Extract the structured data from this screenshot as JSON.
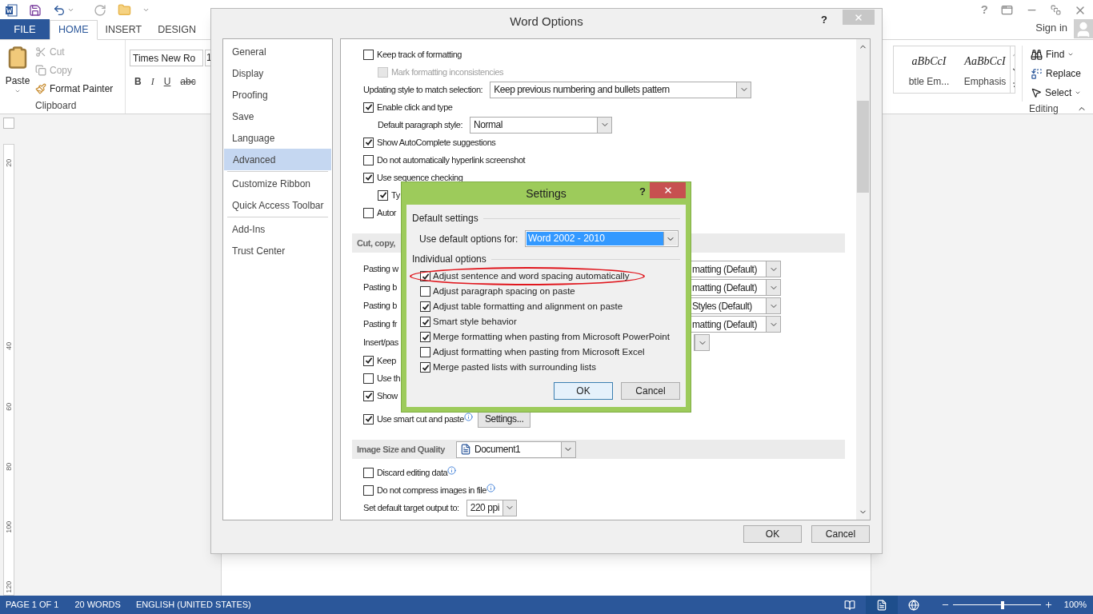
{
  "tabs": [
    {
      "label": "FILE",
      "kind": "file",
      "selected": false
    },
    {
      "label": "HOME",
      "kind": "tab",
      "selected": true
    },
    {
      "label": "INSERT",
      "kind": "tab",
      "selected": false
    },
    {
      "label": "DESIGN",
      "kind": "tab",
      "selected": false
    }
  ],
  "account": {
    "sign_in": "Sign in"
  },
  "ribbon": {
    "clipboard": {
      "paste": "Paste",
      "cut": {
        "label": "Cut",
        "disabled": true
      },
      "copy": {
        "label": "Copy",
        "disabled": true
      },
      "format_painter": "Format Painter",
      "label": "Clipboard"
    },
    "font": {
      "font_name": "Times New Ro",
      "font_size": "1",
      "buttons": [
        {
          "label": "B",
          "kind": "bold"
        },
        {
          "label": "I",
          "kind": "italic"
        },
        {
          "label": "U",
          "kind": "underline"
        },
        {
          "label": "abc",
          "kind": "strike"
        }
      ]
    },
    "styles": [
      {
        "preview": "aBbCcI",
        "label": "btle Em..."
      },
      {
        "preview": "AaBbCcI",
        "label": "Emphasis"
      }
    ],
    "editing": {
      "find": "Find",
      "replace": "Replace",
      "select": "Select",
      "label": "Editing"
    }
  },
  "ruler": {
    "marks": [
      "20",
      "40",
      "60",
      "80",
      "100",
      "120"
    ]
  },
  "options_dialog": {
    "title": "Word Options",
    "help": "?",
    "nav": [
      {
        "label": "General",
        "selected": false
      },
      {
        "label": "Display",
        "selected": false
      },
      {
        "label": "Proofing",
        "selected": false
      },
      {
        "label": "Save",
        "selected": false
      },
      {
        "label": "Language",
        "selected": false
      },
      {
        "label": "Advanced",
        "selected": true
      },
      {
        "label": "Customize Ribbon",
        "selected": false,
        "divider": true
      },
      {
        "label": "Quick Access Toolbar",
        "selected": false
      },
      {
        "label": "Add-Ins",
        "selected": false,
        "divider": true
      },
      {
        "label": "Trust Center",
        "selected": false
      }
    ],
    "rows": [
      {
        "kind": "checkbox",
        "label": "Keep track of formatting",
        "checked": false,
        "children": [
          {
            "kind": "checkbox",
            "label": "Mark formatting inconsistencies",
            "checked": false,
            "disabled": true
          }
        ]
      },
      {
        "kind": "select",
        "label": "Updating style to match selection:",
        "value": "Keep previous numbering and bullets pattern"
      },
      {
        "kind": "checkbox",
        "label": "Enable click and type",
        "checked": true,
        "children": [
          {
            "kind": "select",
            "label": "Default paragraph style:",
            "value": "Normal"
          }
        ]
      },
      {
        "kind": "checkbox",
        "label": "Show AutoComplete suggestions",
        "checked": true
      },
      {
        "kind": "checkbox",
        "label": "Do not automatically hyperlink screenshot",
        "checked": false
      },
      {
        "kind": "checkbox",
        "label": "Use sequence checking",
        "checked": true,
        "children": [
          {
            "kind": "checkbox",
            "label": "Ty",
            "checked": true
          }
        ]
      },
      {
        "kind": "checkbox",
        "label": "Autor",
        "checked": false
      },
      {
        "kind": "section",
        "label": "Cut, copy,"
      },
      {
        "kind": "paste_select",
        "label": "Pasting w",
        "value": "matting (Default)"
      },
      {
        "kind": "paste_select",
        "label": "Pasting b",
        "value": "matting (Default)"
      },
      {
        "kind": "paste_select",
        "label": "Pasting b",
        "value": "Styles (Default)"
      },
      {
        "kind": "paste_select",
        "label": "Pasting fr",
        "value": "matting (Default)"
      },
      {
        "kind": "paste_select",
        "label": "Insert/pas"
      },
      {
        "kind": "checkbox",
        "label": "Keep",
        "checked": true
      },
      {
        "kind": "checkbox",
        "label": "Use th",
        "checked": false
      },
      {
        "kind": "checkbox",
        "label": "Show",
        "checked": true
      },
      {
        "kind": "checkbox",
        "label": "Use smart cut and paste",
        "checked": true,
        "info": true,
        "button": "Settings..."
      },
      {
        "kind": "section",
        "label": "Image Size and Quality",
        "value": "Document1"
      },
      {
        "kind": "checkbox",
        "label": "Discard editing data",
        "checked": false,
        "info": true
      },
      {
        "kind": "checkbox",
        "label": "Do not compress images in file",
        "checked": false,
        "info": true
      },
      {
        "kind": "small_select",
        "label": "Set default target output to:",
        "value": "220 ppi"
      }
    ],
    "buttons": [
      "OK",
      "Cancel"
    ]
  },
  "settings_dialog": {
    "title": "Settings",
    "help": "?",
    "default_group": "Default settings",
    "default_label": "Use default options for:",
    "default_value": "Word 2002 - 2010",
    "individual_group": "Individual options",
    "options": [
      {
        "label": "Adjust sentence and word spacing automatically",
        "checked": true,
        "circled": true
      },
      {
        "label": "Adjust paragraph spacing on paste",
        "checked": false,
        "circled": false
      },
      {
        "label": "Adjust table formatting and alignment on paste",
        "checked": true,
        "circled": false
      },
      {
        "label": "Smart style behavior",
        "checked": true,
        "circled": false
      },
      {
        "label": "Merge formatting when pasting from Microsoft PowerPoint",
        "checked": true,
        "circled": false
      },
      {
        "label": "Adjust formatting when pasting from Microsoft Excel",
        "checked": false,
        "circled": false
      },
      {
        "label": "Merge pasted lists with surrounding lists",
        "checked": true,
        "circled": false
      }
    ],
    "buttons": [
      {
        "label": "OK",
        "selected": true
      },
      {
        "label": "Cancel",
        "selected": false
      }
    ]
  },
  "status_bar": {
    "page": "PAGE 1 OF 1",
    "words": "20 WORDS",
    "language": "ENGLISH (UNITED STATES)",
    "views": [
      {
        "kind": "read",
        "selected": false
      },
      {
        "kind": "print",
        "selected": true
      },
      {
        "kind": "web",
        "selected": false
      }
    ],
    "zoom": {
      "level": 0.55,
      "label": "100%"
    }
  }
}
